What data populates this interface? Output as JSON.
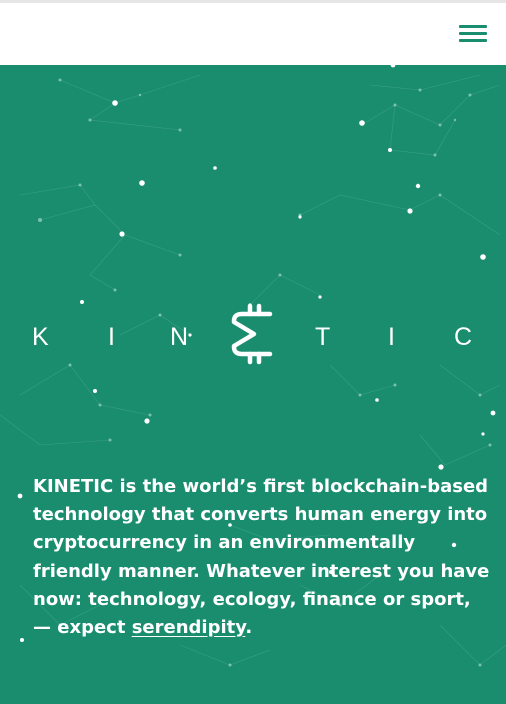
{
  "header": {
    "menu_icon": "hamburger-menu-icon",
    "accent_color": "#1a8d6f"
  },
  "hero": {
    "background_color": "#1a8d6f",
    "logo": {
      "letters": [
        "K",
        "I",
        "N",
        "T",
        "I",
        "C"
      ],
      "symbol": "bitcoin-e-symbol"
    },
    "intro": {
      "text": "KINETIC is the world’s first blockchain-based technology that converts human energy into cryptocurrency in an environmentally friendly manner. Whatever interest you have now: technology, ecology, finance or sport, — expect ",
      "link_label": "serendipity",
      "end": "."
    }
  }
}
